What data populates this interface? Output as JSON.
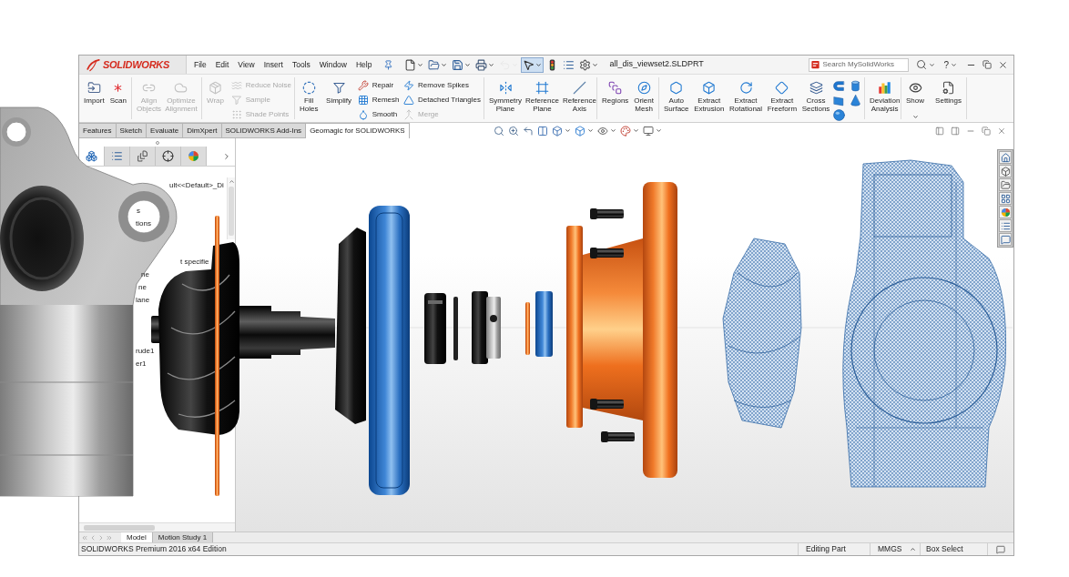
{
  "window": {
    "logo": "SOLIDWORKS",
    "menu": [
      "File",
      "Edit",
      "View",
      "Insert",
      "Tools",
      "Window",
      "Help"
    ],
    "quick_access": [
      {
        "kind": "new",
        "selected": false,
        "disabled": false
      },
      {
        "kind": "open",
        "selected": false,
        "disabled": false
      },
      {
        "kind": "save",
        "selected": false,
        "disabled": false
      },
      {
        "kind": "print",
        "selected": false,
        "disabled": false
      },
      {
        "kind": "undo",
        "selected": false,
        "disabled": true
      },
      {
        "kind": "select",
        "selected": true,
        "disabled": false
      },
      {
        "kind": "rebuild",
        "selected": false,
        "disabled": false
      },
      {
        "kind": "properties",
        "selected": false,
        "disabled": false
      },
      {
        "kind": "options",
        "selected": false,
        "disabled": false
      }
    ],
    "file_name": "all_dis_viewset2.SLDPRT",
    "search": {
      "placeholder": "Search MySolidWorks"
    },
    "help": "?"
  },
  "ribbon": {
    "groups": [
      {
        "columns": [
          {
            "kind": "large",
            "label": "Import",
            "disabled": false
          },
          {
            "kind": "large",
            "label": "Scan",
            "disabled": false
          }
        ]
      },
      {
        "columns": [
          {
            "kind": "large",
            "label": "Align Objects",
            "disabled": true
          },
          {
            "kind": "large",
            "label": "Optimize Alignment",
            "disabled": true
          }
        ]
      },
      {
        "columns": [
          {
            "kind": "large",
            "label": "Wrap",
            "disabled": true
          },
          {
            "kind": "stack",
            "items": [
              {
                "label": "Reduce Noise",
                "disabled": true
              },
              {
                "label": "Sample",
                "disabled": true
              },
              {
                "label": "Shade Points",
                "disabled": true
              }
            ]
          }
        ]
      },
      {
        "columns": [
          {
            "kind": "large",
            "label": "Fill Holes",
            "disabled": false
          },
          {
            "kind": "large",
            "label": "Simplify",
            "disabled": false
          },
          {
            "kind": "stack",
            "items": [
              {
                "label": "Repair",
                "disabled": false
              },
              {
                "label": "Remesh",
                "disabled": false
              },
              {
                "label": "Smooth",
                "disabled": false
              }
            ]
          },
          {
            "kind": "stack",
            "items": [
              {
                "label": "Remove Spikes",
                "disabled": false
              },
              {
                "label": "Detached Triangles",
                "disabled": false
              },
              {
                "label": "Merge",
                "disabled": true
              }
            ]
          }
        ]
      },
      {
        "columns": [
          {
            "kind": "large",
            "label": "Symmetry Plane",
            "disabled": false
          },
          {
            "kind": "large",
            "label": "Reference Plane",
            "disabled": false
          },
          {
            "kind": "large",
            "label": "Reference Axis",
            "disabled": false
          }
        ]
      },
      {
        "columns": [
          {
            "kind": "large",
            "label": "Regions",
            "disabled": false
          },
          {
            "kind": "large",
            "label": "Orient Mesh",
            "disabled": false
          }
        ]
      },
      {
        "columns": [
          {
            "kind": "large",
            "label": "Auto Surface",
            "disabled": false
          },
          {
            "kind": "large",
            "label": "Extract Extrusion",
            "disabled": false
          },
          {
            "kind": "large",
            "label": "Extract Rotational",
            "disabled": false
          },
          {
            "kind": "large",
            "label": "Extract Freeform",
            "disabled": false
          },
          {
            "kind": "large",
            "label": "Cross Sections",
            "disabled": false
          },
          {
            "kind": "shapes"
          }
        ]
      },
      {
        "columns": [
          {
            "kind": "large",
            "label": "Deviation Analysis",
            "disabled": false
          }
        ]
      },
      {
        "columns": [
          {
            "kind": "menu",
            "label": "Show",
            "disabled": false
          },
          {
            "kind": "large",
            "label": "Settings",
            "disabled": false
          }
        ]
      }
    ]
  },
  "command_tabs": [
    {
      "label": "Features",
      "selected": false
    },
    {
      "label": "Sketch",
      "selected": false
    },
    {
      "label": "Evaluate",
      "selected": false
    },
    {
      "label": "DimXpert",
      "selected": false
    },
    {
      "label": "SOLIDWORKS Add-Ins",
      "selected": false
    },
    {
      "label": "Geomagic for SOLIDWORKS",
      "selected": true
    }
  ],
  "feature_manager": {
    "tabs": [
      {
        "selected": true
      },
      {
        "selected": false
      },
      {
        "selected": false
      },
      {
        "selected": false
      },
      {
        "selected": false
      }
    ],
    "tree": [
      {
        "label": "ult<<Default>_Di"
      },
      {
        "label": "s"
      },
      {
        "label": "tions"
      },
      {
        "label": "t specifie"
      },
      {
        "label": "ne"
      },
      {
        "label": "ne"
      },
      {
        "label": "lane"
      },
      {
        "label": "rude1"
      },
      {
        "label": "er1"
      }
    ]
  },
  "document_tabs": [
    {
      "label": "Model",
      "selected": true
    },
    {
      "label": "Motion Study 1",
      "selected": false
    }
  ],
  "status_bar": {
    "edition": "SOLIDWORKS Premium 2016 x64 Edition",
    "mode": "Editing Part",
    "units": "MMGS",
    "selection": "Box Select"
  }
}
